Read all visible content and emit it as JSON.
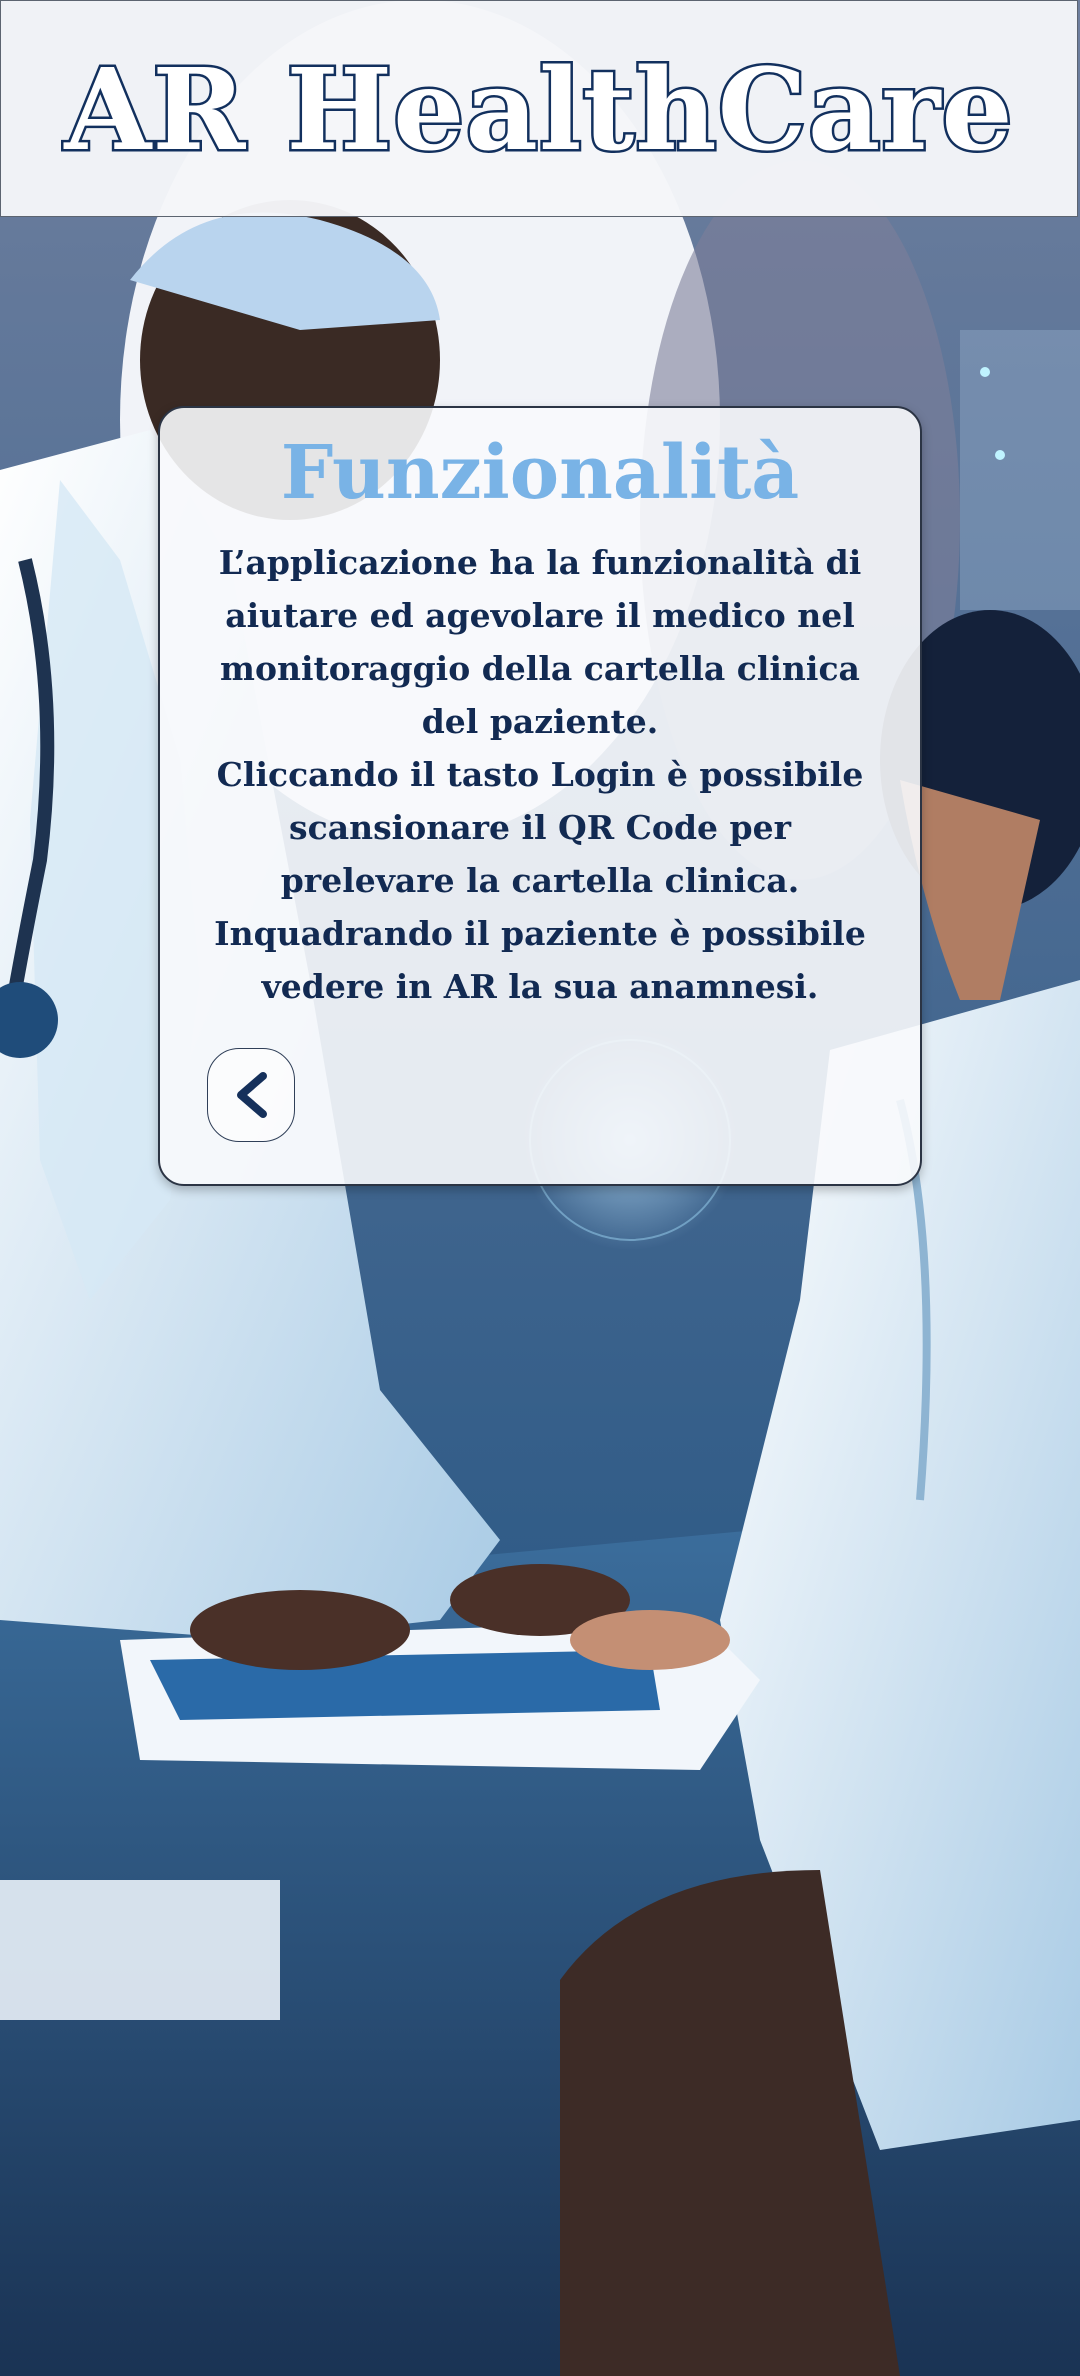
{
  "header": {
    "title": "AR HealthCare"
  },
  "card": {
    "title": "Funzionalità",
    "lines": [
      "L’applicazione ha la funzionalità di",
      "aiutare ed agevolare il medico nel",
      "monitoraggio della cartella clinica",
      "del paziente.",
      "Cliccando il tasto Login è possibile",
      "scansionare il QR Code per",
      "prelevare la cartella clinica.",
      "Inquadrando il paziente è possibile",
      "vedere in AR la sua anamnesi."
    ],
    "back_icon": "chevron-left-icon"
  },
  "colors": {
    "title_outline": "#12305e",
    "card_title": "#79b3e6",
    "body_text": "#122a52",
    "background_dark": "#1c3550",
    "background_light": "#cfe3f2"
  }
}
